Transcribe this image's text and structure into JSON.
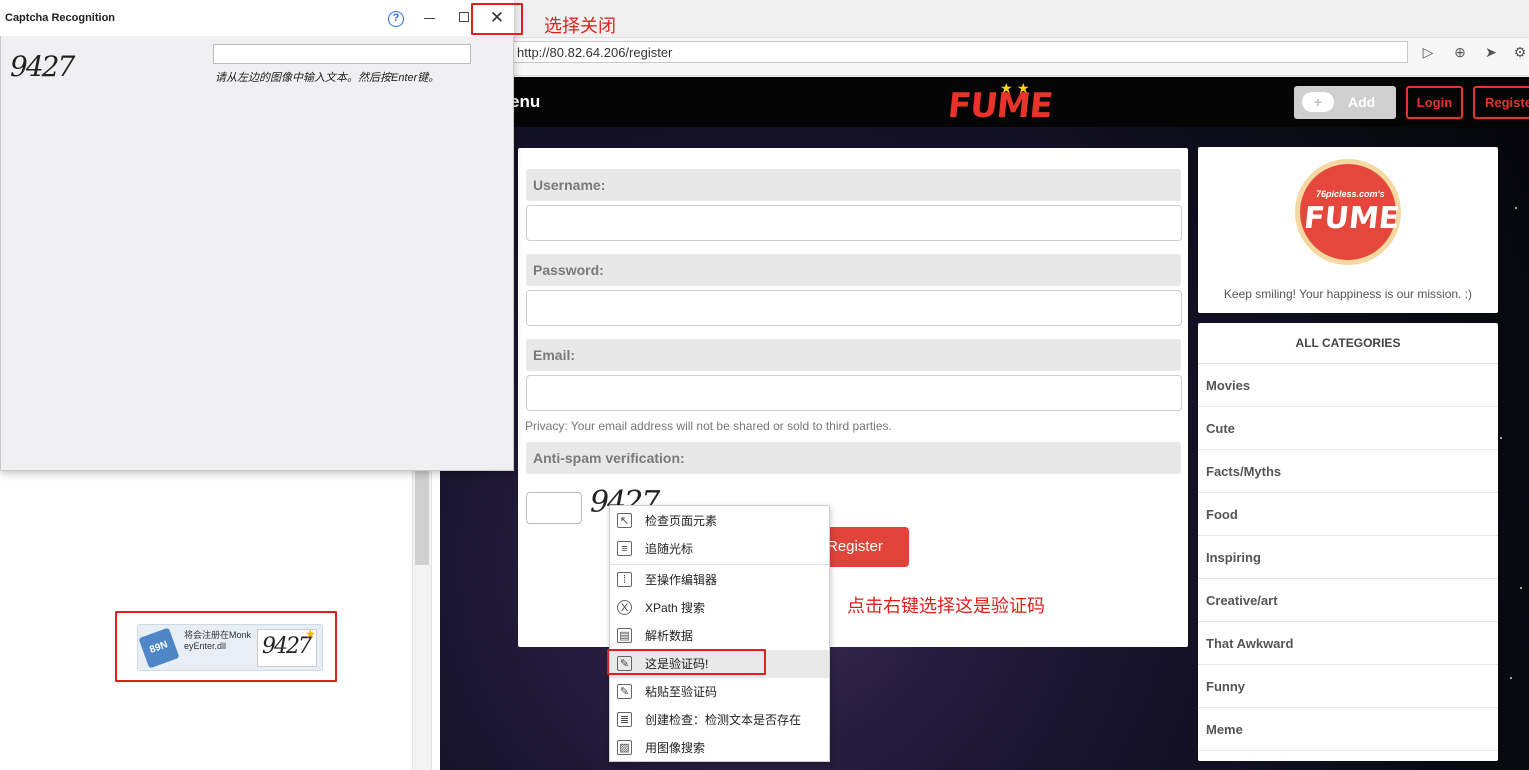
{
  "dialog": {
    "title": "Captcha Recognition",
    "help_glyph": "?",
    "close_glyph": "✕",
    "captcha_text": "9427",
    "hint": "请从左边的图像中输入文本。然后按Enter键。",
    "input_value": ""
  },
  "notification": {
    "icon_text": "89N",
    "text": "将会注册在MonkeyEnter.dll",
    "thumb_text": "9427",
    "star": "★"
  },
  "browser": {
    "url": "http://80.82.64.206/register",
    "nav_icons": [
      "play-icon",
      "plus-circle-icon",
      "cursor-icon",
      "extension-icon"
    ]
  },
  "site": {
    "menu_label": "enu",
    "logo_text": "FUME",
    "add_label": "Add",
    "add_icon": "+",
    "login_label": "Login",
    "register_label": "Register"
  },
  "form": {
    "username_label": "Username:",
    "password_label": "Password:",
    "email_label": "Email:",
    "privacy_text": "Privacy: Your email address will not be shared or sold to third parties.",
    "antispam_label": "Anti-spam verification:",
    "captcha_text": "9427",
    "submit_label": "Register"
  },
  "sidebar": {
    "logo_small": "76picless.com's",
    "logo_text": "FUME",
    "mission": "Keep smiling! Your happiness is our mission. :)",
    "categories_title": "ALL CATEGORIES",
    "categories": [
      "Movies",
      "Cute",
      "Facts/Myths",
      "Food",
      "Inspiring",
      "Creative/art",
      "That Awkward",
      "Funny",
      "Meme"
    ]
  },
  "context_menu": {
    "items": [
      {
        "label": "检查页面元素",
        "icon": "inspect-icon"
      },
      {
        "label": "追随光标",
        "icon": "follow-cursor-icon"
      },
      {
        "label": "至操作编辑器",
        "icon": "editor-icon"
      },
      {
        "label": "XPath 搜索",
        "icon": "xpath-icon"
      },
      {
        "label": "解析数据",
        "icon": "parse-data-icon"
      },
      {
        "label": "这是验证码!",
        "icon": "captcha-icon"
      },
      {
        "label": "粘贴至验证码",
        "icon": "paste-captcha-icon"
      },
      {
        "label": "创建检查：检测文本是否存在",
        "icon": "check-text-icon"
      },
      {
        "label": "用图像搜索",
        "icon": "image-search-icon"
      }
    ]
  },
  "annotations": {
    "close_note": "选择关闭",
    "right_click_note": "点击右键选择这是验证码"
  },
  "colors": {
    "accent_red": "#e8332a",
    "annotation_red": "#e0201b",
    "submit_red": "#e0443b"
  }
}
